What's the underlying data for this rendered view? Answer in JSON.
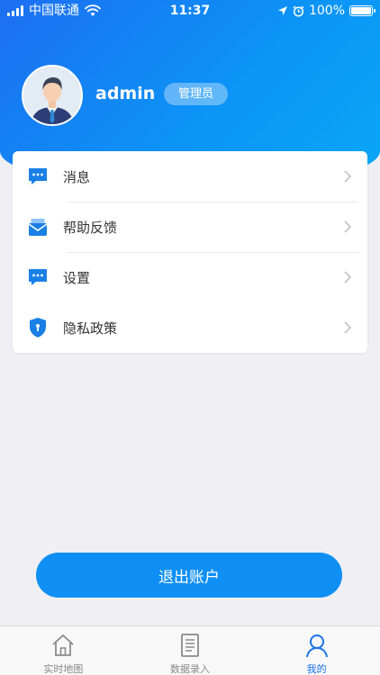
{
  "status_bar": {
    "carrier": "中国联通",
    "time": "11:37",
    "battery": "100%"
  },
  "profile": {
    "username": "admin",
    "role": "管理员"
  },
  "menu": {
    "items": [
      {
        "label": "消息",
        "icon": "message-icon"
      },
      {
        "label": "帮助反馈",
        "icon": "mail-icon"
      },
      {
        "label": "设置",
        "icon": "settings-message-icon"
      },
      {
        "label": "隐私政策",
        "icon": "shield-icon"
      }
    ]
  },
  "logout": {
    "label": "退出账户"
  },
  "tabbar": {
    "items": [
      {
        "label": "实时地图",
        "icon": "home-icon",
        "active": false
      },
      {
        "label": "数据录入",
        "icon": "document-icon",
        "active": false
      },
      {
        "label": "我的",
        "icon": "user-icon",
        "active": true
      }
    ]
  },
  "colors": {
    "accent": "#0f8ff4",
    "header_start": "#1d6ff2",
    "header_end": "#0aa8f7",
    "tab_active": "#1a73e8",
    "tab_inactive": "#8a8a8a"
  }
}
